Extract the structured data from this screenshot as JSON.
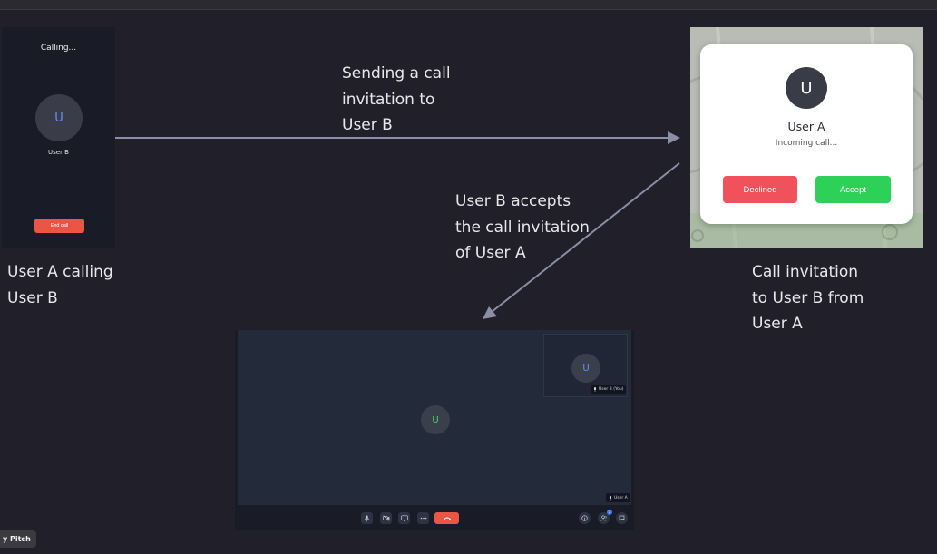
{
  "captions": {
    "sending": "Sending a call\ninvitation to\nUser B",
    "accepts": "User B accepts\nthe call invitation\nof User A",
    "calling": "User A calling\nUser B",
    "invitation": "Call invitation\nto User B from\nUser A"
  },
  "calling_screen": {
    "title": "Calling...",
    "avatar_initial": "U",
    "name": "User B",
    "end_call_label": "End call"
  },
  "incoming_screen": {
    "avatar_initial": "U",
    "caller_name": "User A",
    "status": "Incoming call...",
    "decline_label": "Declined",
    "accept_label": "Accept"
  },
  "in_call_screen": {
    "remote_avatar_initial": "U",
    "remote_tag": "User B (You)",
    "main_avatar_initial": "U",
    "self_tag": "User A",
    "participants_badge": "2"
  },
  "brand": "y Pitch",
  "colors": {
    "background": "#211f29",
    "arrow": "#8c8ea6",
    "end_call": "#eb5545",
    "decline": "#f1515b",
    "accept": "#2ed158"
  },
  "icons": [
    "mic-icon",
    "camera-off-icon",
    "screen-share-icon",
    "more-icon",
    "hang-up-icon",
    "info-icon",
    "participants-icon",
    "chat-icon"
  ]
}
